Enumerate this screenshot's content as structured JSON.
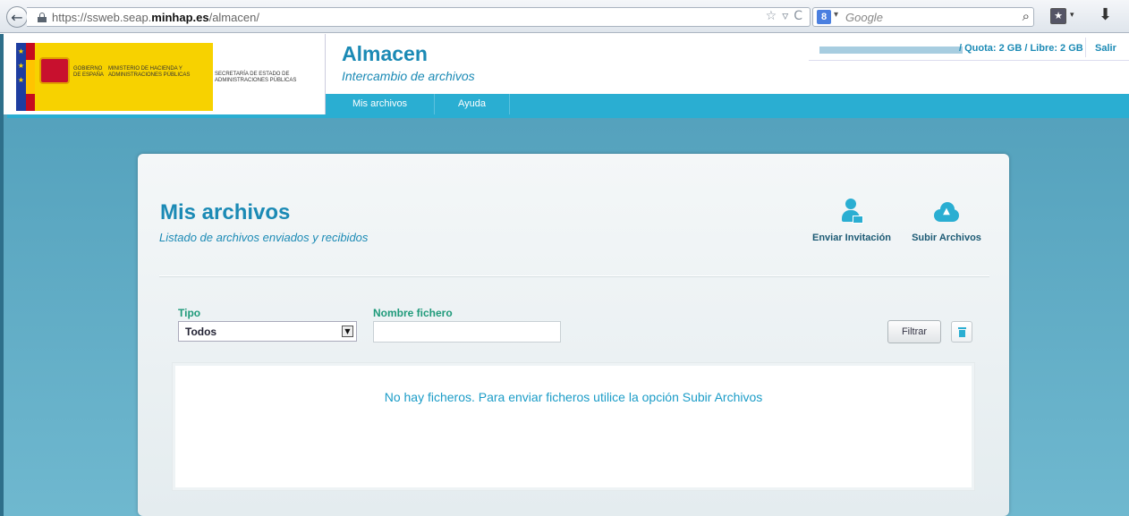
{
  "browser": {
    "back_glyph": "←",
    "url_prefix": "https://ssweb.seap.",
    "url_domain": "minhap.es",
    "url_path": "/almacen/",
    "url_icons": [
      "star-icon",
      "dropdown-icon",
      "reload-icon"
    ],
    "star_glyph": "☆",
    "dropdown_glyph": "▿",
    "reload_glyph": "C",
    "search_engine_letter": "8",
    "search_dropdown_glyph": "▾",
    "search_placeholder": "Google",
    "search_glyph": "⌕",
    "bookmarks_glyph": "★",
    "bookmarks_dropdown_glyph": "▾",
    "download_glyph": "⬇"
  },
  "header": {
    "logo": {
      "gov_text": "GOBIERNO DE ESPAÑA",
      "ministry_text": "MINISTERIO DE HACIENDA Y ADMINISTRACIONES PÚBLICAS",
      "secretariat_text": "SECRETARÍA DE ESTADO DE ADMINISTRACIONES PÚBLICAS"
    },
    "app_title": "Almacen",
    "app_subtitle": "Intercambio de archivos",
    "quota_text": "/ Quota: 2 GB / Libre: 2 GB",
    "logout_label": "Salir"
  },
  "nav": {
    "items": [
      {
        "label": "Mis archivos"
      },
      {
        "label": "Ayuda"
      }
    ]
  },
  "main": {
    "title": "Mis archivos",
    "subtitle": "Listado de archivos enviados y recibidos",
    "actions": {
      "invite_label": "Enviar Invitación",
      "upload_label": "Subir Archivos",
      "upload_arrow_glyph": "▲"
    },
    "filters": {
      "type_label": "Tipo",
      "type_value": "Todos",
      "type_dropdown_glyph": "▼",
      "filename_label": "Nombre fichero",
      "filename_value": "",
      "filter_button_label": "Filtrar"
    },
    "empty_message": "No hay ficheros. Para enviar ficheros utilice la opción Subir Archivos"
  },
  "colors": {
    "accent": "#1b8ab5",
    "nav_bg": "#2aaed2",
    "label_green": "#1f9a7a",
    "page_bg": "#5ba9c4"
  }
}
